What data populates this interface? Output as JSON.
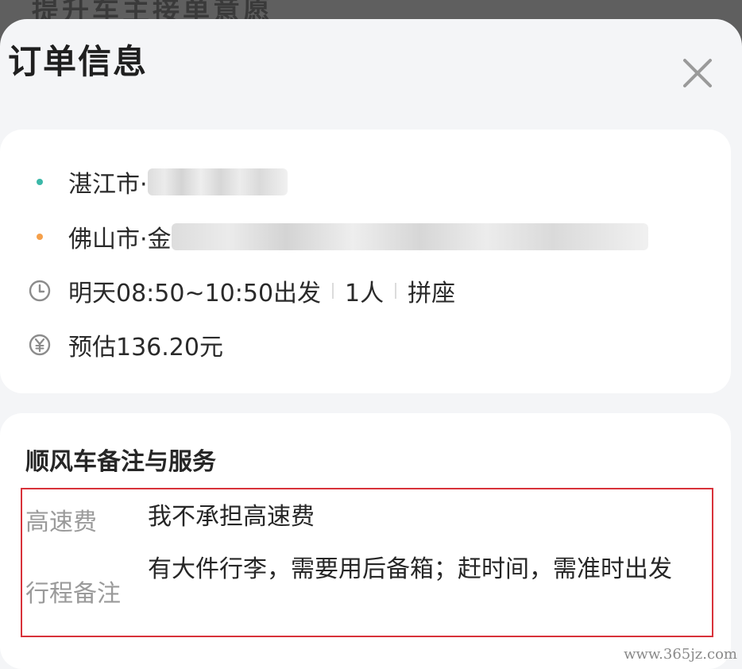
{
  "background_hint": "提升车主接单意愿",
  "header": {
    "title": "订单信息",
    "close_icon": "close-icon"
  },
  "order": {
    "origin": {
      "city": "湛江市·",
      "dot_color": "#3bb8a8"
    },
    "destination": {
      "city": "佛山市·金",
      "dot_color": "#f5a04a"
    },
    "schedule": {
      "icon": "clock-icon",
      "time": "明天08:50~10:50出发",
      "passengers": "1人",
      "ride_type": "拼座"
    },
    "price": {
      "icon": "yuan-icon",
      "text": "预估136.20元"
    }
  },
  "service": {
    "title": "顺风车备注与服务",
    "items": [
      {
        "label": "高速费",
        "value": "我不承担高速费"
      },
      {
        "label": "行程备注",
        "value": "有大件行李，需要用后备箱；赶时间，需准时出发"
      }
    ]
  },
  "watermark": "www.365jz.com",
  "colors": {
    "highlight_border": "#d8323a",
    "sheet_background": "#f4f5f7",
    "card_background": "#ffffff"
  }
}
